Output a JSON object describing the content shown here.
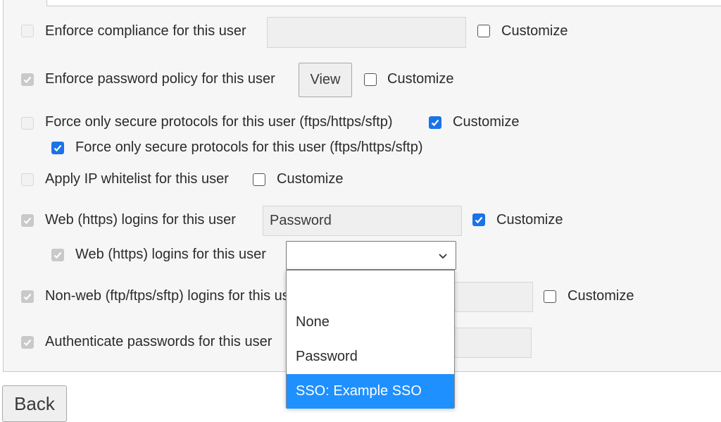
{
  "rows": {
    "compliance": {
      "label": "Enforce compliance for this user",
      "value": "",
      "customize": "Customize"
    },
    "password_policy": {
      "label": "Enforce password policy for this user",
      "view_label": "View",
      "customize": "Customize"
    },
    "secure_protocols": {
      "label": "Force only secure protocols for this user (ftps/https/sftp)",
      "customize": "Customize",
      "sub_label": "Force only secure protocols for this user (ftps/https/sftp)"
    },
    "ip_whitelist": {
      "label": "Apply IP whitelist for this user",
      "customize": "Customize"
    },
    "web_logins": {
      "label": "Web (https) logins for this user",
      "value": "Password",
      "customize": "Customize",
      "sub_label": "Web (https) logins for this user",
      "select_value": ""
    },
    "nonweb_logins": {
      "label": "Non-web (ftp/ftps/sftp) logins for this user",
      "value": "",
      "customize": "Customize"
    },
    "auth_passwords": {
      "label": "Authenticate passwords for this user",
      "value": ""
    }
  },
  "dropdown": {
    "options": [
      "",
      "None",
      "Password",
      "SSO: Example SSO"
    ],
    "highlighted": "SSO: Example SSO"
  },
  "back_label": "Back",
  "colors": {
    "accent": "#1a73e8",
    "highlight": "#1e90ff"
  }
}
